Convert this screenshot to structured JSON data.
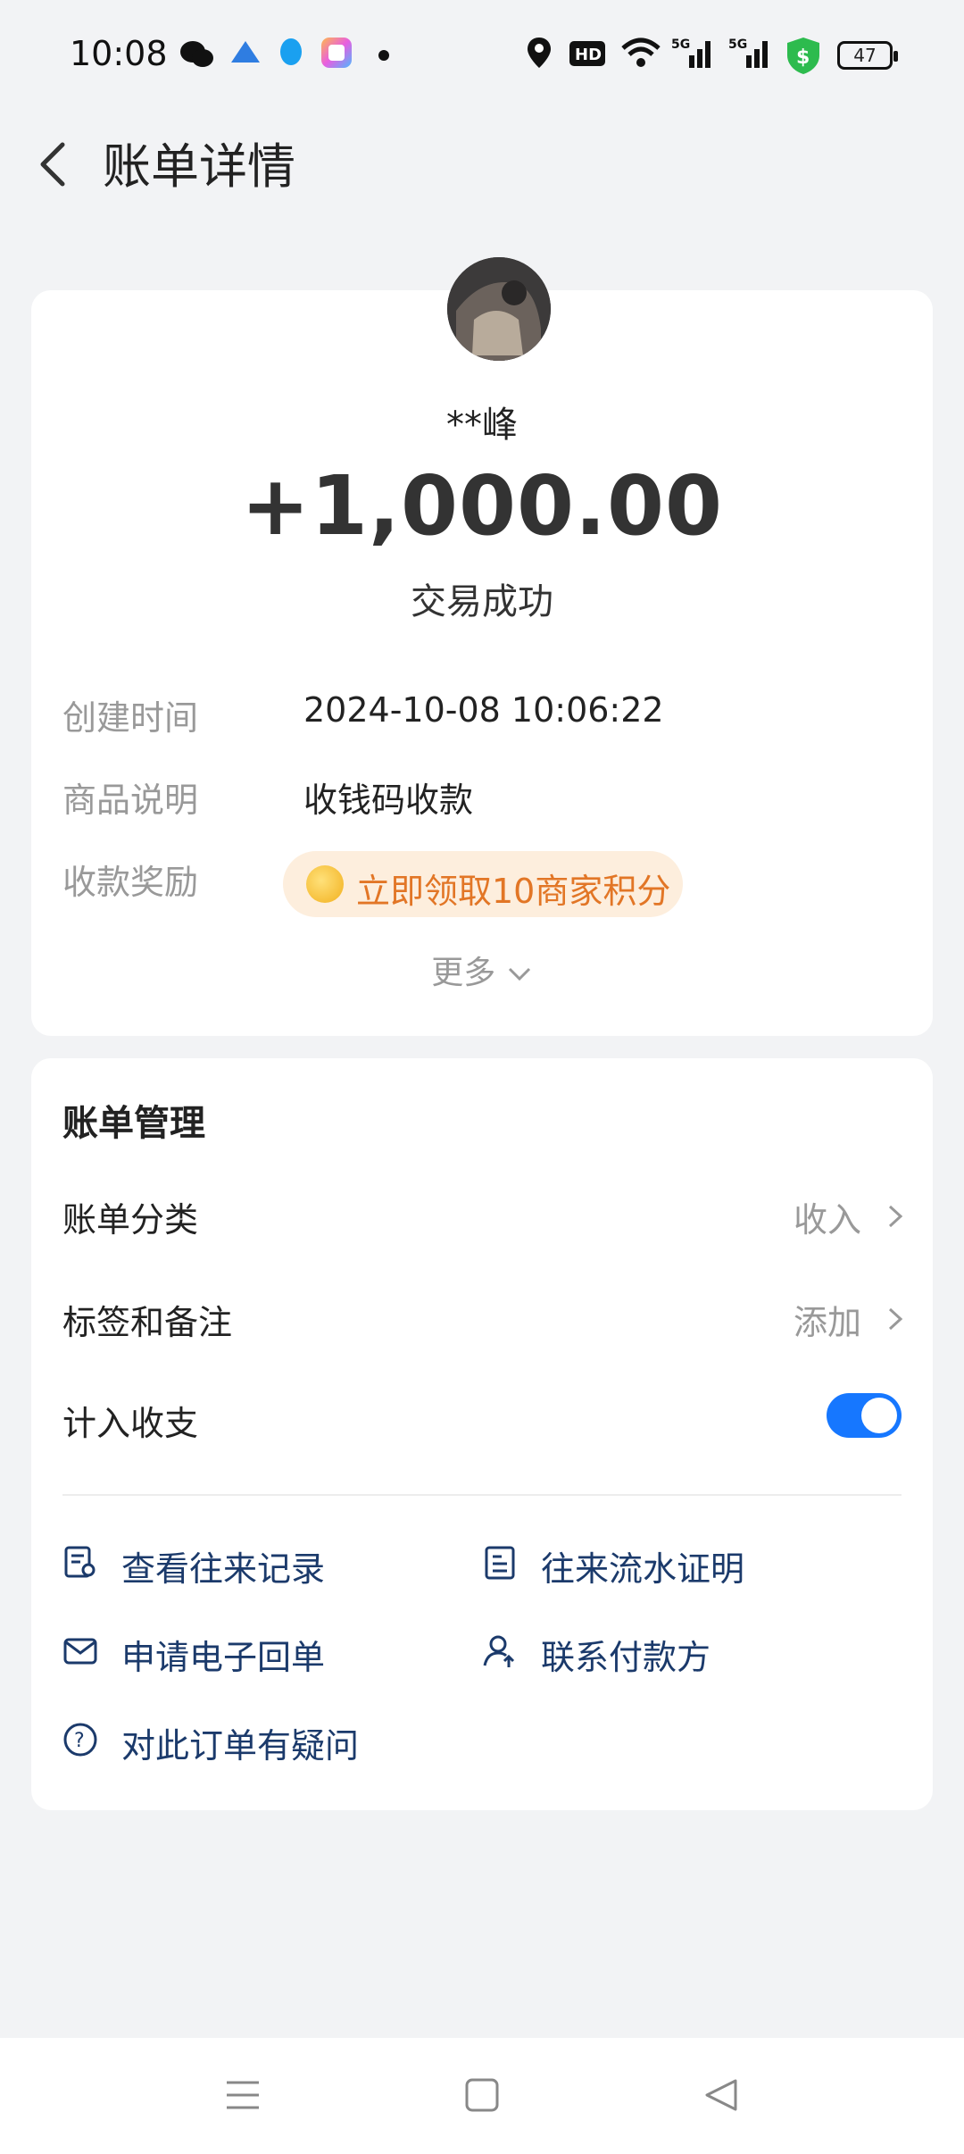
{
  "status_bar": {
    "time": "10:08",
    "icons": [
      "wechat-icon",
      "app-icon",
      "qq-icon",
      "gallery-icon",
      "dot-icon",
      "location-icon",
      "hd-icon",
      "wifi-icon",
      "signal-5g-icon",
      "signal-5g-icon",
      "security-icon"
    ],
    "battery": "47"
  },
  "header": {
    "title": "账单详情",
    "back_icon": "chevron-left-icon"
  },
  "summary": {
    "payer": "**峰",
    "amount": "+1,000.00",
    "status": "交易成功",
    "rows": [
      {
        "label": "创建时间",
        "value": "2024-10-08 10:06:22"
      },
      {
        "label": "商品说明",
        "value": "收钱码收款"
      },
      {
        "label": "收款奖励",
        "value": "立即领取10商家积分"
      }
    ],
    "more": "更多"
  },
  "management": {
    "title": "账单管理",
    "category_label": "账单分类",
    "category_value": "收入",
    "tags_label": "标签和备注",
    "tags_value": "添加",
    "include_label": "计入收支",
    "include_on": true,
    "links": [
      {
        "label": "查看往来记录",
        "icon": "records-icon"
      },
      {
        "label": "往来流水证明",
        "icon": "statement-icon"
      },
      {
        "label": "申请电子回单",
        "icon": "mail-icon"
      },
      {
        "label": "联系付款方",
        "icon": "contact-icon"
      },
      {
        "label": "对此订单有疑问",
        "icon": "question-icon"
      }
    ]
  },
  "colors": {
    "accent": "#1677ff",
    "reward": "#e27626",
    "link": "#1b3a6b"
  }
}
